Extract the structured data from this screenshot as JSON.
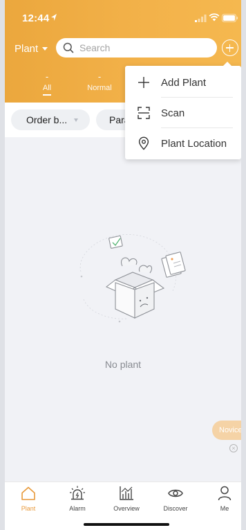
{
  "status_bar": {
    "time": "12:44"
  },
  "header": {
    "plant_selector_label": "Plant",
    "search": {
      "placeholder": "Search",
      "value": ""
    },
    "stats": [
      {
        "value": "-",
        "label": "All",
        "active": true
      },
      {
        "value": "-",
        "label": "Normal",
        "active": false
      }
    ]
  },
  "filters": {
    "order_by": "Order b...",
    "param": "Para"
  },
  "dropdown_menu": {
    "items": [
      {
        "label": "Add Plant",
        "icon": "plus-icon"
      },
      {
        "label": "Scan",
        "icon": "scan-icon"
      },
      {
        "label": "Plant Location",
        "icon": "location-pin-icon"
      }
    ]
  },
  "empty_state": {
    "text": "No plant"
  },
  "novice": {
    "label": "Novice"
  },
  "tabbar": {
    "tabs": [
      {
        "label": "Plant",
        "icon": "home-icon",
        "active": true
      },
      {
        "label": "Alarm",
        "icon": "alarm-light-icon",
        "active": false
      },
      {
        "label": "Overview",
        "icon": "chart-icon",
        "active": false
      },
      {
        "label": "Discover",
        "icon": "eye-icon",
        "active": false
      },
      {
        "label": "Me",
        "icon": "person-icon",
        "active": false
      }
    ]
  },
  "colors": {
    "accent": "#eba73d",
    "background": "#f1f2f6",
    "active_tab": "#e8993a"
  }
}
